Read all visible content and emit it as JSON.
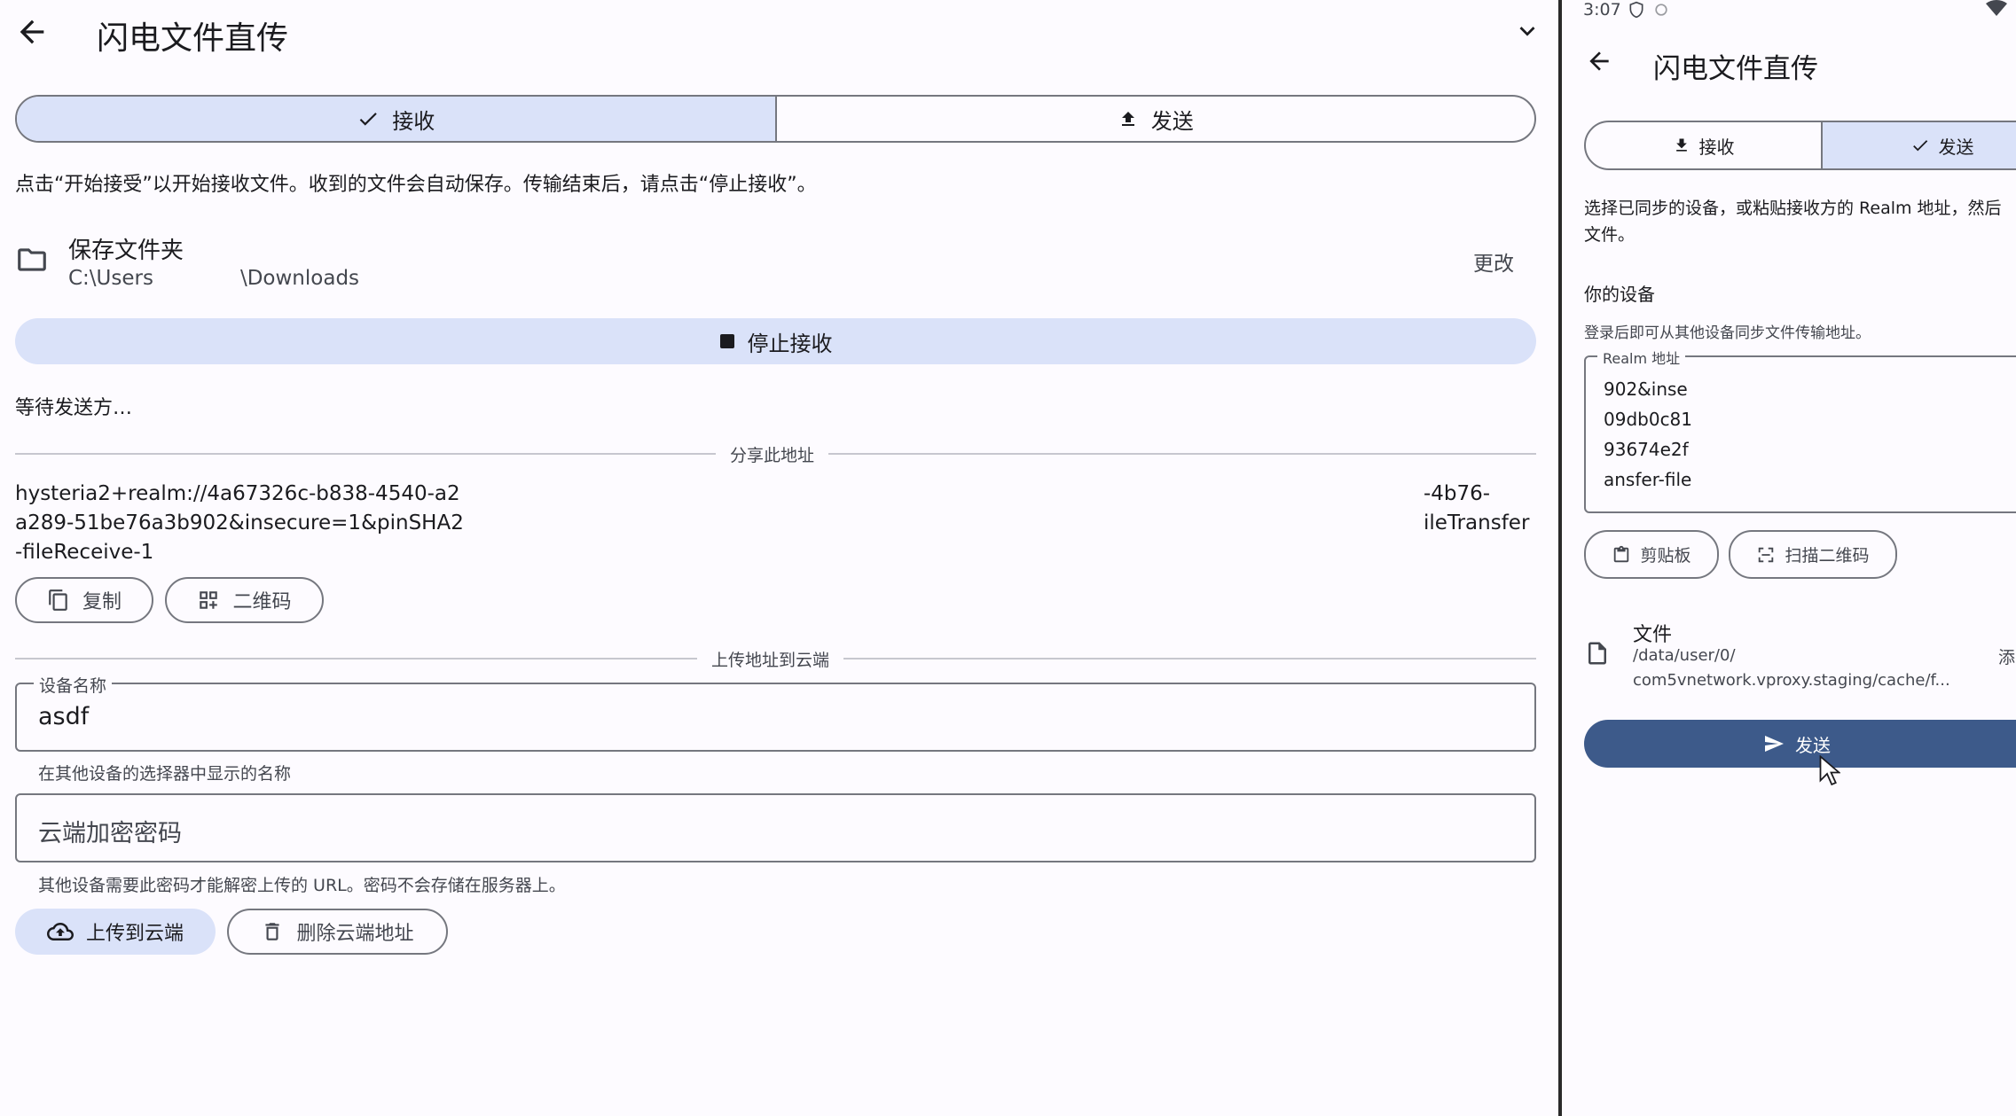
{
  "desktop": {
    "title": "闪电文件直传",
    "tabs": {
      "receive": "接收",
      "send": "发送"
    },
    "description": "点击“开始接受”以开始接收文件。收到的文件会自动保存。传输结束后，请点击“停止接收”。",
    "folder": {
      "label": "保存文件夹",
      "path_start": "C:\\Users",
      "path_end": "\\Downloads",
      "change": "更改"
    },
    "stop_button": "停止接收",
    "status": "等待发送方…",
    "share_divider": "分享此地址",
    "share_address": {
      "line1_left": "hysteria2+realm://4a67326c-b838-4540-a2",
      "line1_right": "-4b76-",
      "line2_left": "a289-51be76a3b902&insecure=1&pinSHA2",
      "line2_right": "ileTransfer",
      "line3": "-fileReceive-1"
    },
    "copy_button": "复制",
    "qr_button": "二维码",
    "upload_divider": "上传地址到云端",
    "device_name": {
      "label": "设备名称",
      "value": "asdf",
      "helper": "在其他设备的选择器中显示的名称"
    },
    "password": {
      "placeholder": "云端加密密码",
      "helper": "其他设备需要此密码才能解密上传的 URL。密码不会存储在服务器上。"
    },
    "upload_button": "上传到云端",
    "delete_button": "删除云端地址"
  },
  "phone": {
    "status_time": "3:07",
    "title": "闪电文件直传",
    "tabs": {
      "receive": "接收",
      "send": "发送"
    },
    "description_line1": "选择已同步的设备，或粘贴接收方的 Realm 地址，然后",
    "description_line2": "文件。",
    "your_devices": "你的设备",
    "login_hint": "登录后即可从其他设备同步文件传输地址。",
    "realm_field": {
      "label": "Realm 地址",
      "lines": [
        "902&inse",
        "09db0c81",
        "93674e2f",
        "ansfer-file"
      ]
    },
    "clipboard_button": "剪贴板",
    "scan_button": "扫描二维码",
    "file": {
      "label": "文件",
      "path1": "/data/user/0/",
      "path2": "com5vnetwork.vproxy.staging/cache/f...",
      "add": "添"
    },
    "send_button": "发送"
  },
  "colors": {
    "selected": "#dae2f9",
    "primary": "#3d5a8a",
    "outline": "#75777f",
    "background": "#fdfbff"
  }
}
